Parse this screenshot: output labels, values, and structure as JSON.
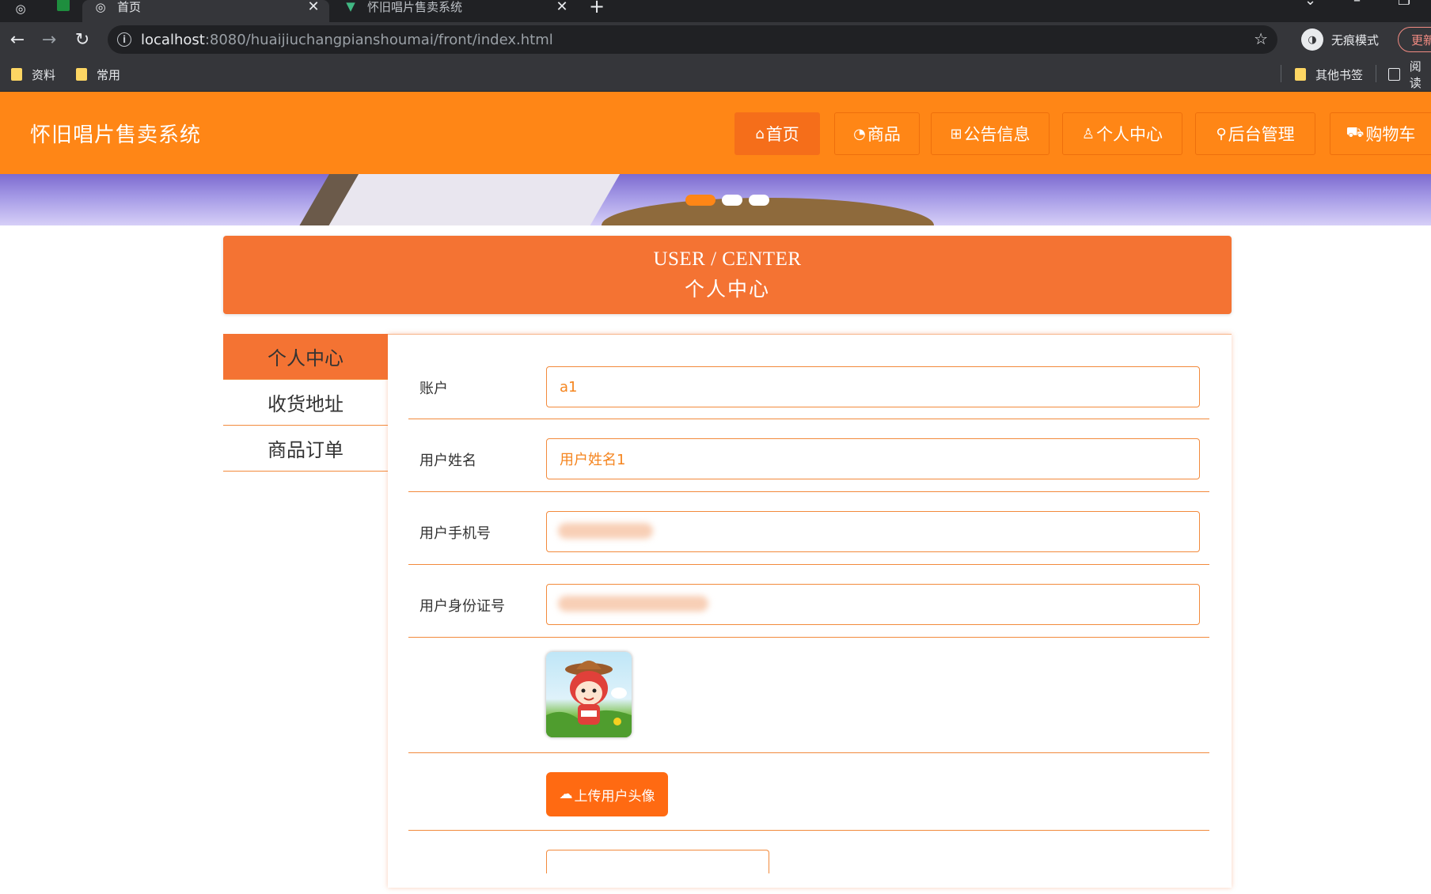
{
  "browser": {
    "tabs": [
      {
        "label": "首页",
        "active": true
      },
      {
        "label": "怀旧唱片售卖系统",
        "active": false
      }
    ],
    "url_host": "localhost",
    "url_rest": ":8080/huaijiuchangpianshoumai/front/index.html",
    "incognito_label": "无痕模式",
    "update_label": "更新",
    "bookmarks": [
      "资料",
      "常用"
    ],
    "other_bookmarks": "其他书签",
    "reading_list": "阅读"
  },
  "site": {
    "title": "怀旧唱片售卖系统",
    "nav": [
      {
        "icon": "⌂",
        "label": "首页",
        "active": true
      },
      {
        "icon": "◔",
        "label": "商品",
        "active": false
      },
      {
        "icon": "⊞",
        "label": "公告信息",
        "active": false
      },
      {
        "icon": "♙",
        "label": "个人中心",
        "active": false
      },
      {
        "icon": "⚲",
        "label": "后台管理",
        "active": false
      },
      {
        "icon": "⛟",
        "label": "购物车",
        "active": false
      }
    ],
    "accent_color": "#ff8616"
  },
  "banner": {
    "slides": 3,
    "active_slide": 0
  },
  "user_center": {
    "title_en": "USER / CENTER",
    "title_cn": "个人中心",
    "side_menu": [
      {
        "label": "个人中心",
        "active": true
      },
      {
        "label": "收货地址",
        "active": false
      },
      {
        "label": "商品订单",
        "active": false
      }
    ],
    "form": {
      "account": {
        "label": "账户",
        "value": "a1"
      },
      "name": {
        "label": "用户姓名",
        "value": "用户姓名1"
      },
      "phone": {
        "label": "用户手机号",
        "value": ""
      },
      "id_card": {
        "label": "用户身份证号",
        "value": ""
      },
      "upload_label": "上传用户头像"
    }
  }
}
